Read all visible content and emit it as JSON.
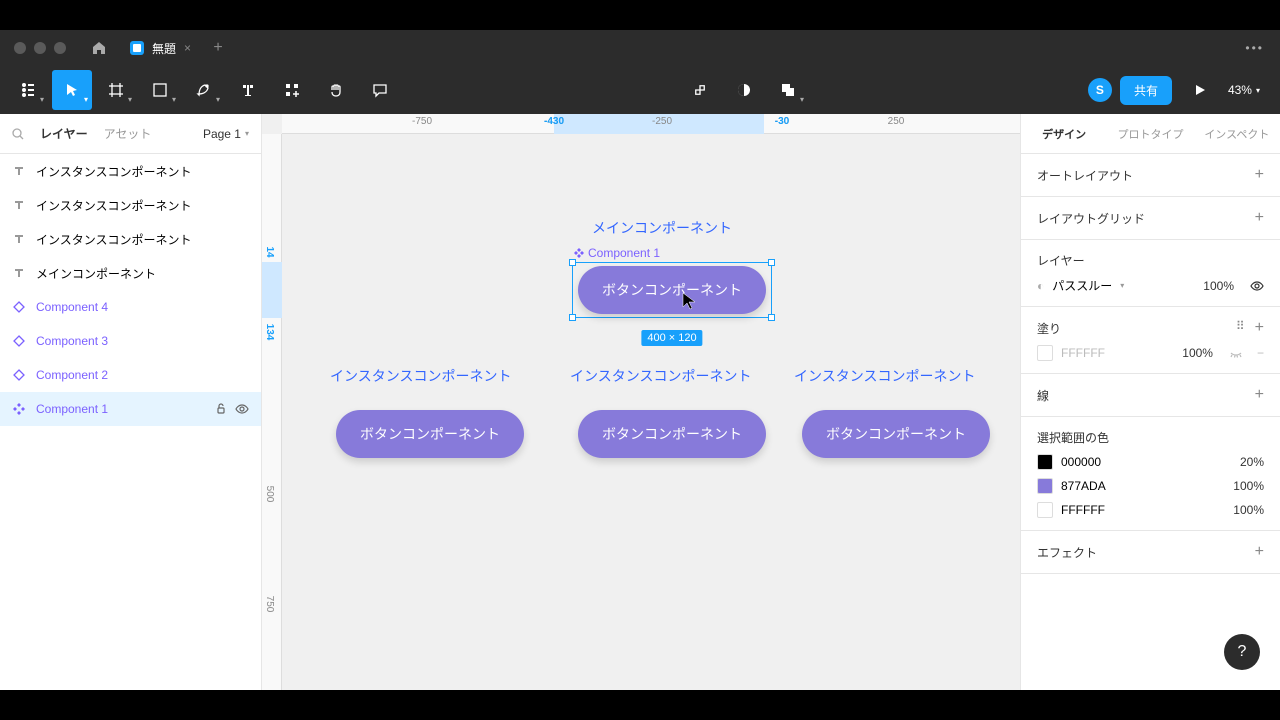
{
  "titleBar": {
    "tabTitle": "無題"
  },
  "toolbar": {
    "avatar": "S",
    "share": "共有",
    "zoom": "43%"
  },
  "leftPanel": {
    "tabLayers": "レイヤー",
    "tabAssets": "アセット",
    "page": "Page 1",
    "layers": [
      {
        "type": "text",
        "label": "インスタンスコンポーネント"
      },
      {
        "type": "text",
        "label": "インスタンスコンポーネント"
      },
      {
        "type": "text",
        "label": "インスタンスコンポーネント"
      },
      {
        "type": "text",
        "label": "メインコンポーネント"
      },
      {
        "type": "instance",
        "label": "Component 4"
      },
      {
        "type": "instance",
        "label": "Component 3"
      },
      {
        "type": "instance",
        "label": "Component 2"
      },
      {
        "type": "component",
        "label": "Component 1",
        "selected": true
      }
    ]
  },
  "rulerH": [
    "-750",
    "-430",
    "-250",
    "-30",
    "250"
  ],
  "rulerHSelTicks": [
    "-430",
    "-30"
  ],
  "rulerV": [
    "500",
    "750"
  ],
  "rulerVSelTicks": [
    "14",
    "134"
  ],
  "canvas": {
    "mainLabel": "メインコンポーネント",
    "componentLabel": "Component 1",
    "buttonText": "ボタンコンポーネント",
    "instanceLabel": "インスタンスコンポーネント",
    "dimensions": "400 × 120"
  },
  "rightPanel": {
    "tabs": [
      "デザイン",
      "プロトタイプ",
      "インスペクト"
    ],
    "autoLayout": "オートレイアウト",
    "layoutGrid": "レイアウトグリッド",
    "layer": "レイヤー",
    "passThrough": "パススルー",
    "passThroughPct": "100%",
    "fill": "塗り",
    "fillHex": "FFFFFF",
    "fillPct": "100%",
    "stroke": "線",
    "selectionColors": "選択範囲の色",
    "colors": [
      {
        "hex": "000000",
        "pct": "20%",
        "bg": "#000000"
      },
      {
        "hex": "877ADA",
        "pct": "100%",
        "bg": "#877ADA"
      },
      {
        "hex": "FFFFFF",
        "pct": "100%",
        "bg": "#FFFFFF"
      }
    ],
    "effects": "エフェクト"
  }
}
